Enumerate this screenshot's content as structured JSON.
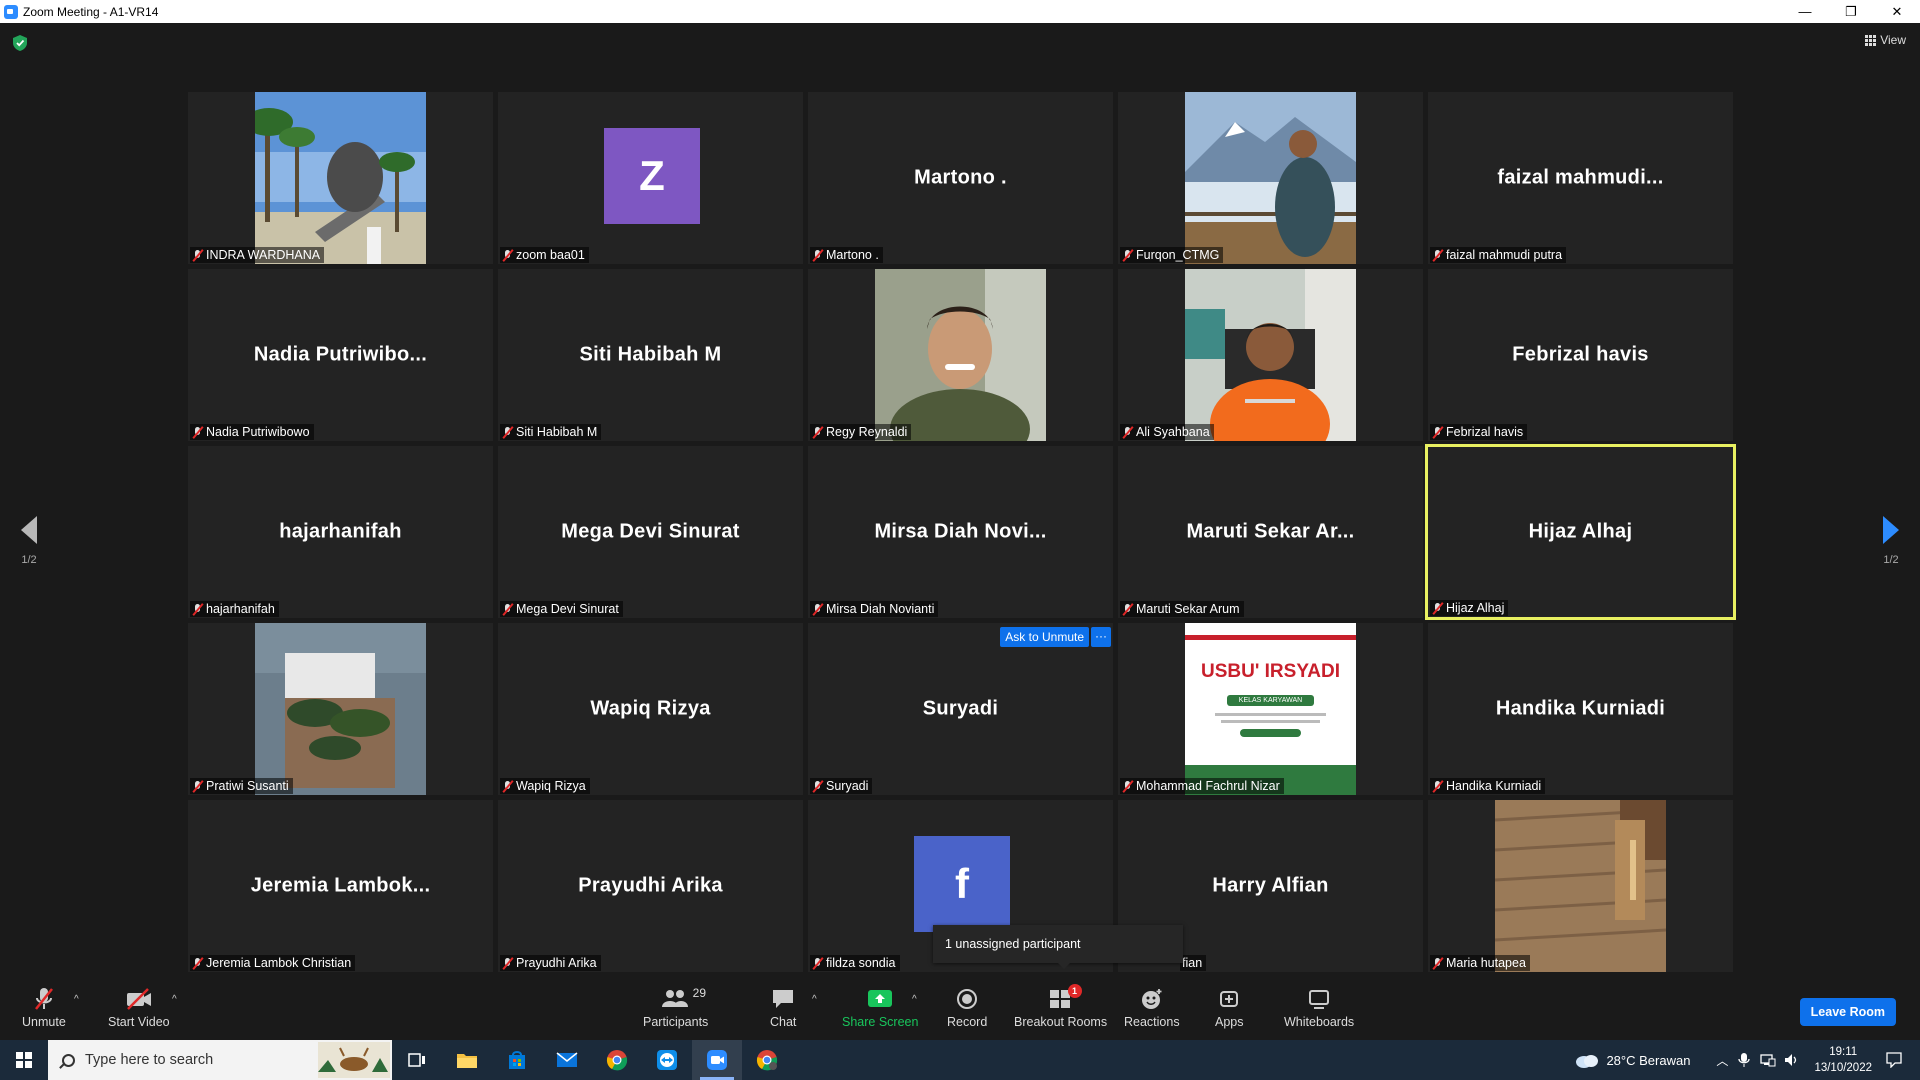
{
  "window": {
    "title": "Zoom Meeting - A1-VR14",
    "min": "—",
    "max": "❐",
    "close": "✕"
  },
  "view_label": "View",
  "page_indicator_left": "1/2",
  "page_indicator_right": "1/2",
  "tiles": [
    {
      "name": "INDRA WARDHANA"
    },
    {
      "name": "zoom baa01",
      "avatar": "Z"
    },
    {
      "name": "Martono .",
      "display": "Martono ."
    },
    {
      "name": "Furqon_CTMG"
    },
    {
      "name": "faizal mahmudi putra",
      "display": "faizal  mahmudi..."
    },
    {
      "name": "Nadia Putriwibowo",
      "display": "Nadia  Putriwibo..."
    },
    {
      "name": "Siti Habibah M",
      "display": "Siti Habibah M"
    },
    {
      "name": "Regy Reynaldi"
    },
    {
      "name": "Ali Syahbana"
    },
    {
      "name": "Febrizal havis",
      "display": "Febrizal havis"
    },
    {
      "name": "hajarhanifah",
      "display": "hajarhanifah"
    },
    {
      "name": "Mega Devi Sinurat",
      "display": "Mega Devi Sinurat"
    },
    {
      "name": "Mirsa Diah Novianti",
      "display": "Mirsa  Diah  Novi..."
    },
    {
      "name": "Maruti Sekar Arum",
      "display": "Maruti  Sekar  Ar..."
    },
    {
      "name": "Hijaz Alhaj",
      "display": "Hijaz Alhaj"
    },
    {
      "name": "Pratiwi Susanti"
    },
    {
      "name": "Wapiq Rizya",
      "display": "Wapiq Rizya"
    },
    {
      "name": "Suryadi",
      "display": "Suryadi",
      "ask_unmute": "Ask to Unmute",
      "more": "···"
    },
    {
      "name": "Mohammad Fachrul Nizar",
      "poster_title": "USBU' IRSYADI",
      "poster_sub": "KELAS KARYAWAN"
    },
    {
      "name": "Handika Kurniadi",
      "display": "Handika Kurniadi"
    },
    {
      "name": "Jeremia Lambok Christian",
      "display": "Jeremia  Lambok..."
    },
    {
      "name": "Prayudhi Arika",
      "display": "Prayudhi Arika"
    },
    {
      "name": "fildza sondia",
      "avatar": "f"
    },
    {
      "name": "fian",
      "display": "Harry Alfian"
    },
    {
      "name": "Maria hutapea"
    }
  ],
  "tooltip": "1 unassigned participant",
  "toolbar": {
    "unmute": "Unmute",
    "start_video": "Start Video",
    "participants": "Participants",
    "participants_count": "29",
    "chat": "Chat",
    "share_screen": "Share Screen",
    "record": "Record",
    "breakout_rooms": "Breakout Rooms",
    "breakout_badge": "1",
    "reactions": "Reactions",
    "apps": "Apps",
    "whiteboards": "Whiteboards",
    "leave": "Leave Room",
    "caret": "^"
  },
  "taskbar": {
    "search_placeholder": "Type here to search",
    "weather": "28°C  Berawan",
    "time": "19:11",
    "date": "13/10/2022"
  },
  "colors": {
    "accent": "#0e71eb",
    "active_speaker": "#e8f061",
    "share_green": "#19c55c",
    "muted_red": "#e02828"
  }
}
